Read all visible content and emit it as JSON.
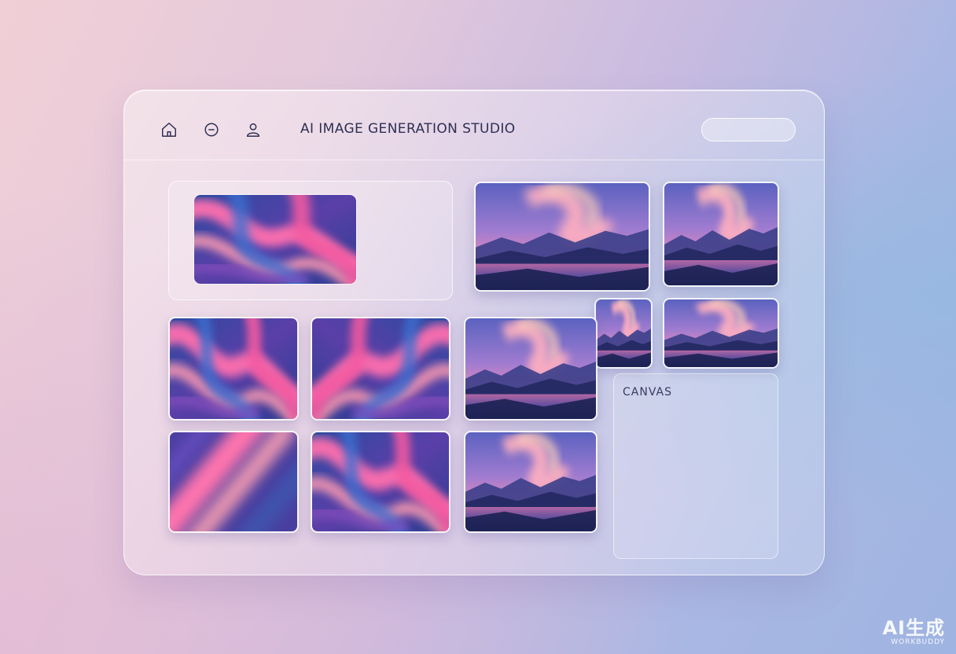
{
  "app": {
    "title": "AI IMAGE GENERATION STUDIO"
  },
  "nav": {
    "icons": [
      "home-icon",
      "minus-circle-icon",
      "user-icon"
    ]
  },
  "canvas": {
    "label": "CANVAS"
  },
  "watermark": {
    "main": "AI生成",
    "sub": "WORKBUDDY"
  },
  "colors": {
    "accent_pink": "#f46aa8",
    "accent_blue": "#3b5bb0",
    "deep_navy": "#1f2656",
    "text": "#2e2f52"
  }
}
